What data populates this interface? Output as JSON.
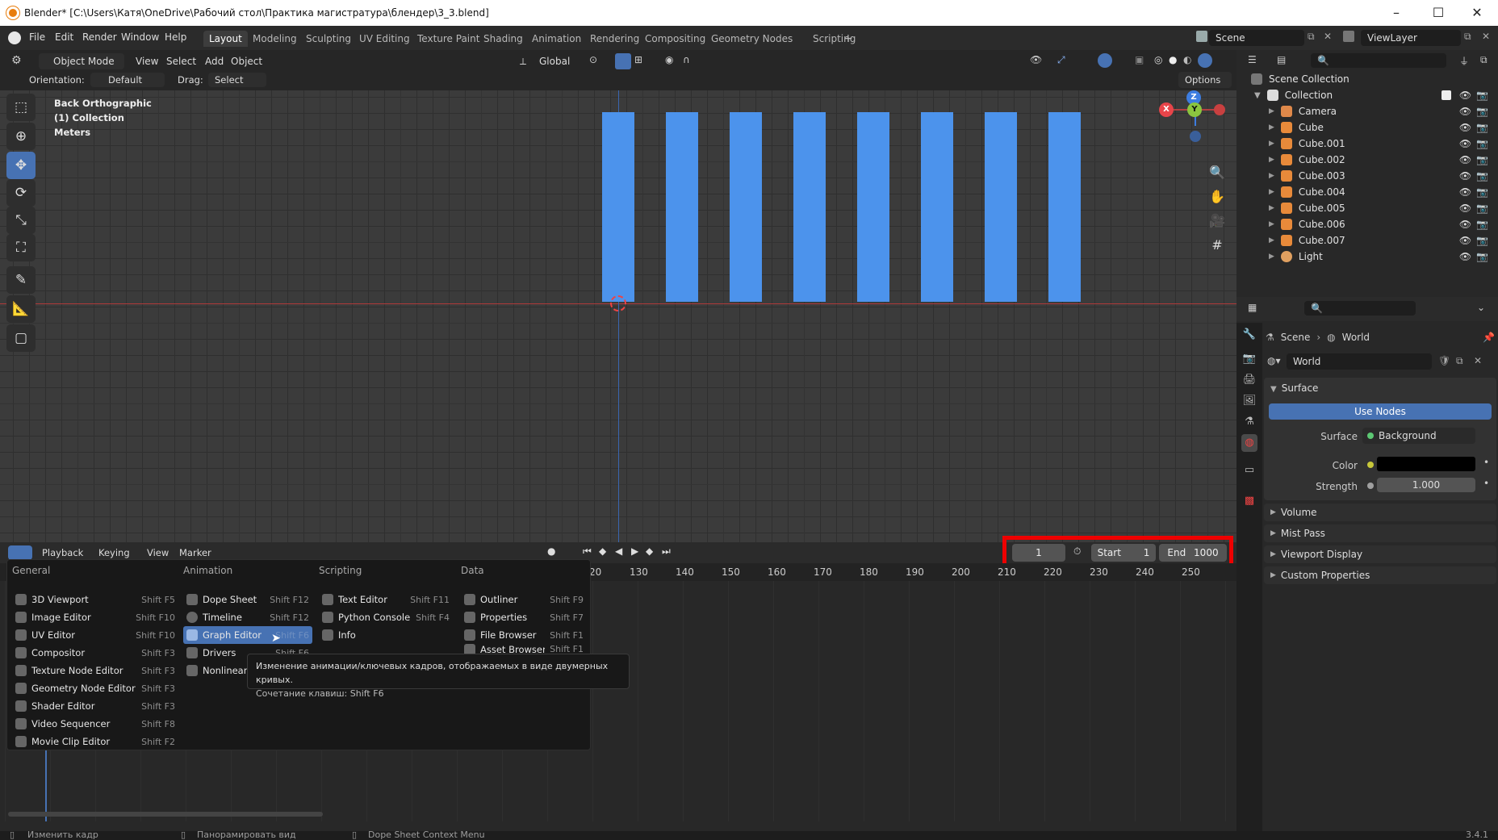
{
  "window": {
    "title": "Blender* [C:\\Users\\Катя\\OneDrive\\Рабочий стол\\Практика магистратура\\блендер\\3_3.blend]",
    "minimize": "–",
    "maximize": "☐",
    "close": "✕"
  },
  "menubar": {
    "items": [
      "File",
      "Edit",
      "Render",
      "Window",
      "Help"
    ]
  },
  "workspaces": {
    "tabs": [
      "Layout",
      "Modeling",
      "Sculpting",
      "UV Editing",
      "Texture Paint",
      "Shading",
      "Animation",
      "Rendering",
      "Compositing",
      "Geometry Nodes",
      "Scripting",
      "+"
    ],
    "active": "Layout"
  },
  "scene": {
    "name": "Scene",
    "view_layer": "ViewLayer"
  },
  "viewport_header": {
    "mode": "Object Mode",
    "menus": [
      "View",
      "Select",
      "Add",
      "Object"
    ],
    "transform": "Global",
    "orientation_label": "Orientation:",
    "orientation_value": "Default",
    "drag_label": "Drag:",
    "drag_value": "Select Box",
    "options": "Options"
  },
  "viewport": {
    "view_name": "Back Orthographic",
    "collection_info": "(1) Collection",
    "units": "Meters",
    "bars": 8,
    "gizmo": {
      "x": "X",
      "y": "Y",
      "z": "Z"
    }
  },
  "timeline": {
    "editor_menus": [
      "Playback",
      "Keying",
      "View",
      "Marker"
    ],
    "current_frame": "1",
    "start_label": "Start",
    "start": "1",
    "end_label": "End",
    "end": "1000",
    "ticks": [
      "20",
      "130",
      "140",
      "150",
      "160",
      "170",
      "180",
      "190",
      "200",
      "210",
      "220",
      "230",
      "240",
      "250"
    ]
  },
  "editor_menu": {
    "columns": [
      {
        "title": "General",
        "items": [
          {
            "name": "3D Viewport",
            "shortcut": "Shift F5",
            "icon": "3d-viewport-icon"
          },
          {
            "name": "Image Editor",
            "shortcut": "Shift F10",
            "icon": "image-editor-icon"
          },
          {
            "name": "UV Editor",
            "shortcut": "Shift F10",
            "icon": "uv-editor-icon"
          },
          {
            "name": "Compositor",
            "shortcut": "Shift F3",
            "icon": "compositor-icon"
          },
          {
            "name": "Texture Node Editor",
            "shortcut": "Shift F3",
            "icon": "texture-node-icon"
          },
          {
            "name": "Geometry Node Editor",
            "shortcut": "Shift F3",
            "icon": "geometry-node-icon"
          },
          {
            "name": "Shader Editor",
            "shortcut": "Shift F3",
            "icon": "shader-editor-icon"
          },
          {
            "name": "Video Sequencer",
            "shortcut": "Shift F8",
            "icon": "video-sequencer-icon"
          },
          {
            "name": "Movie Clip Editor",
            "shortcut": "Shift F2",
            "icon": "movie-clip-icon"
          }
        ]
      },
      {
        "title": "Animation",
        "items": [
          {
            "name": "Dope Sheet",
            "shortcut": "Shift F12",
            "icon": "dope-sheet-icon"
          },
          {
            "name": "Timeline",
            "shortcut": "Shift F12",
            "icon": "timeline-icon"
          },
          {
            "name": "Graph Editor",
            "shortcut": "Shift F6",
            "icon": "graph-editor-icon"
          },
          {
            "name": "Drivers",
            "shortcut": "Shift F6",
            "icon": "drivers-icon"
          },
          {
            "name": "Nonlinear A",
            "shortcut": "",
            "icon": "nla-icon"
          }
        ]
      },
      {
        "title": "Scripting",
        "items": [
          {
            "name": "Text Editor",
            "shortcut": "Shift F11",
            "icon": "text-editor-icon"
          },
          {
            "name": "Python Console",
            "shortcut": "Shift F4",
            "icon": "python-console-icon"
          },
          {
            "name": "Info",
            "shortcut": "",
            "icon": "info-icon"
          }
        ]
      },
      {
        "title": "Data",
        "items": [
          {
            "name": "Outliner",
            "shortcut": "Shift F9",
            "icon": "outliner-icon"
          },
          {
            "name": "Properties",
            "shortcut": "Shift F7",
            "icon": "properties-icon"
          },
          {
            "name": "File Browser",
            "shortcut": "Shift F1",
            "icon": "file-browser-icon"
          },
          {
            "name": "Asset Browser",
            "shortcut": "Shift F1",
            "icon": "asset-browser-icon"
          }
        ]
      }
    ],
    "tooltip": {
      "description": "Изменение анимации/ключевых кадров, отображаемых в виде двумерных кривых.",
      "shortcut": "Сочетание клавиш: Shift F6"
    }
  },
  "outliner": {
    "root": "Scene Collection",
    "collection": "Collection",
    "items": [
      {
        "name": "Camera",
        "type": "camera"
      },
      {
        "name": "Cube",
        "type": "mesh"
      },
      {
        "name": "Cube.001",
        "type": "mesh"
      },
      {
        "name": "Cube.002",
        "type": "mesh"
      },
      {
        "name": "Cube.003",
        "type": "mesh"
      },
      {
        "name": "Cube.004",
        "type": "mesh"
      },
      {
        "name": "Cube.005",
        "type": "mesh"
      },
      {
        "name": "Cube.006",
        "type": "mesh"
      },
      {
        "name": "Cube.007",
        "type": "mesh"
      },
      {
        "name": "Light",
        "type": "light"
      }
    ]
  },
  "properties": {
    "breadcrumb": [
      "Scene",
      "World"
    ],
    "world_name": "World",
    "surface_panel": "Surface",
    "use_nodes": "Use Nodes",
    "surface_label": "Surface",
    "surface_value": "Background",
    "color_label": "Color",
    "color_value": "#000000",
    "strength_label": "Strength",
    "strength_value": "1.000",
    "panels": [
      "Volume",
      "Mist Pass",
      "Viewport Display",
      "Custom Properties"
    ]
  },
  "statusbar": {
    "items": [
      "Изменить кадр",
      "Панорамировать вид",
      "Dope Sheet Context Menu"
    ],
    "version": "3.4.1"
  },
  "colors": {
    "accent": "#4772b3",
    "object": "#4c93ec",
    "highlight_box": "#ee0000",
    "x_axis": "#e8454a",
    "y_axis": "#8bc53f",
    "z_axis": "#3d7de0"
  }
}
